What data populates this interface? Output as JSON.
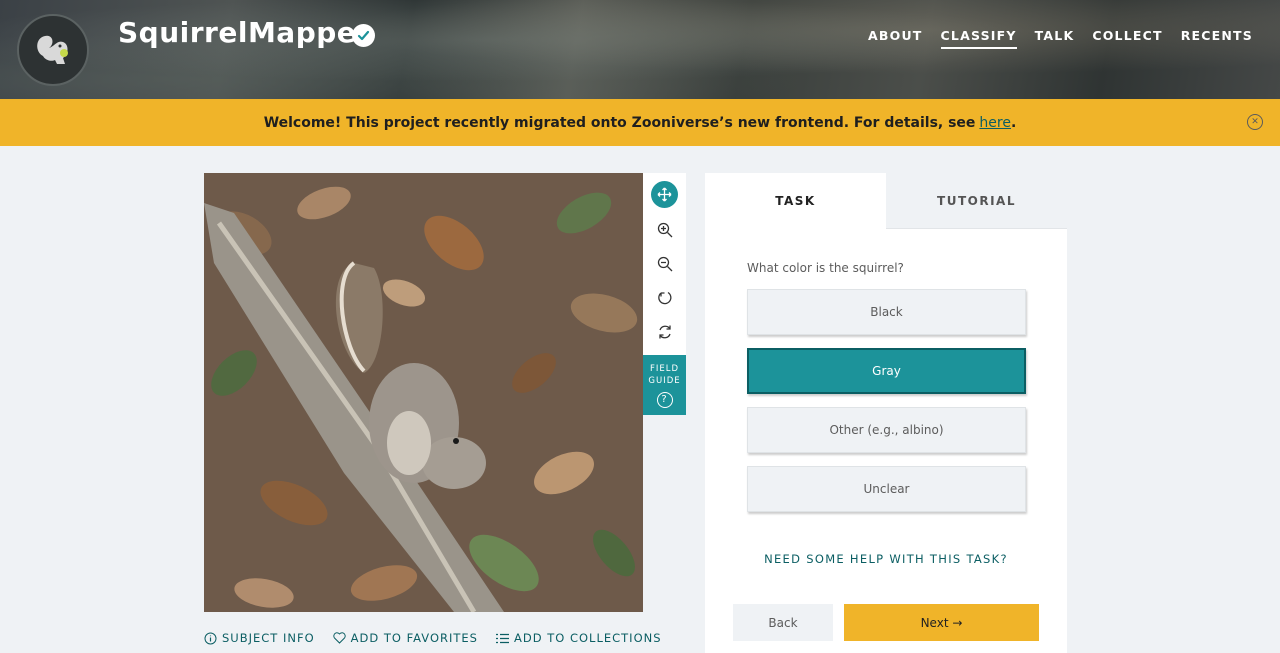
{
  "header": {
    "project_title": "SquirrelMapper",
    "nav": [
      {
        "label": "ABOUT",
        "active": false
      },
      {
        "label": "CLASSIFY",
        "active": true
      },
      {
        "label": "TALK",
        "active": false
      },
      {
        "label": "COLLECT",
        "active": false
      },
      {
        "label": "RECENTS",
        "active": false
      }
    ]
  },
  "banner": {
    "text": "Welcome! This project recently migrated onto Zooniverse’s new frontend. For details, see",
    "link_text": "here",
    "after_link": ".",
    "color": "#f0b429"
  },
  "toolbar": {
    "tools": [
      "move-icon",
      "zoom-in-icon",
      "zoom-out-icon",
      "rotate-icon",
      "reset-icon"
    ],
    "field_guide_line1": "FIELD",
    "field_guide_line2": "GUIDE",
    "field_guide_icon": "?"
  },
  "meta": {
    "subject_info": "SUBJECT INFO",
    "add_to_favorites": "ADD TO FAVORITES",
    "add_to_collections": "ADD TO COLLECTIONS"
  },
  "task_panel": {
    "tab_task": "TASK",
    "tab_tutorial": "TUTORIAL",
    "question": "What color is the squirrel?",
    "answers": [
      {
        "label": "Black",
        "selected": false
      },
      {
        "label": "Gray",
        "selected": true
      },
      {
        "label": "Other (e.g., albino)",
        "selected": false
      },
      {
        "label": "Unclear",
        "selected": false
      }
    ],
    "help": "NEED SOME HELP WITH THIS TASK?",
    "back": "Back",
    "next": "Next →"
  },
  "colors": {
    "accent": "#1c939a",
    "dark_teal": "#0b5e63",
    "gold": "#f0b429"
  }
}
